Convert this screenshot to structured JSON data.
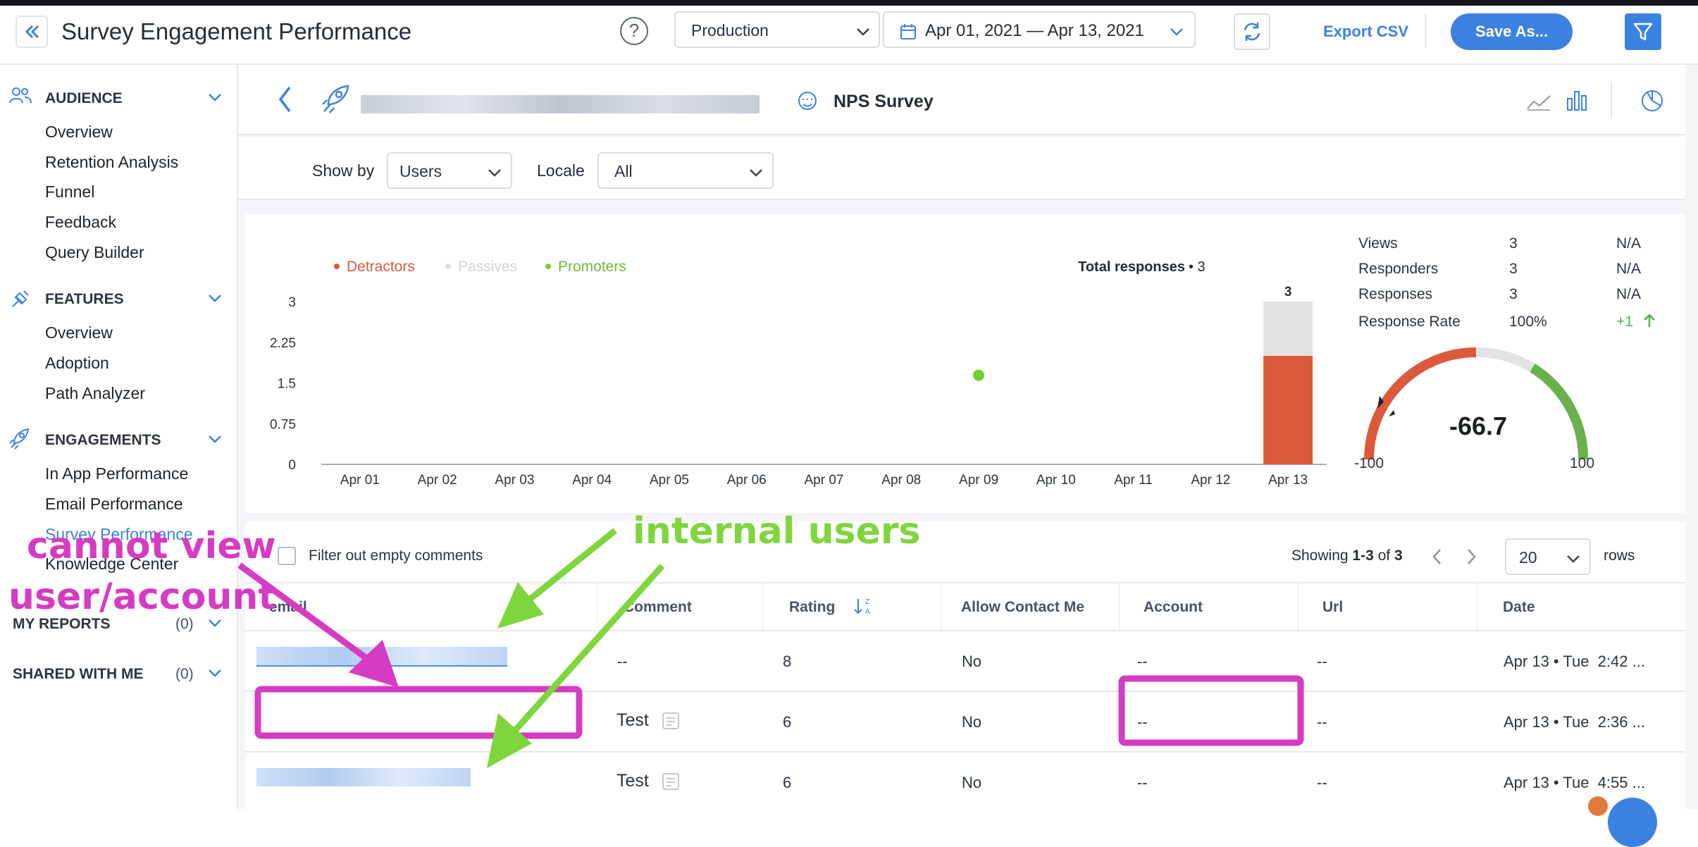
{
  "header": {
    "title": "Survey Engagement Performance",
    "environment": "Production",
    "date_range": "Apr 01, 2021 — Apr 13, 2021",
    "export_label": "Export CSV",
    "save_label": "Save As..."
  },
  "sidebar": {
    "audience": {
      "title": "AUDIENCE",
      "items": [
        "Overview",
        "Retention Analysis",
        "Funnel",
        "Feedback",
        "Query Builder"
      ]
    },
    "features": {
      "title": "FEATURES",
      "items": [
        "Overview",
        "Adoption",
        "Path Analyzer"
      ]
    },
    "engagements": {
      "title": "ENGAGEMENTS",
      "items": [
        "In App Performance",
        "Email Performance",
        "Survey Performance",
        "Knowledge Center"
      ]
    },
    "my_reports": {
      "title": "MY REPORTS",
      "count": "(0)"
    },
    "shared": {
      "title": "SHARED WITH ME",
      "count": "(0)"
    }
  },
  "subheader": {
    "survey_name": "NPS Survey"
  },
  "filters": {
    "show_by_label": "Show by",
    "show_by_value": "Users",
    "locale_label": "Locale",
    "locale_value": "All"
  },
  "chart_data": {
    "type": "bar",
    "legend": [
      "Detractors",
      "Passives",
      "Promoters"
    ],
    "colors": {
      "detractors": "#dc5a3c",
      "passives": "#e3e3e3",
      "promoters": "#6fcf2f"
    },
    "categories": [
      "Apr 01",
      "Apr 02",
      "Apr 03",
      "Apr 04",
      "Apr 05",
      "Apr 06",
      "Apr 07",
      "Apr 08",
      "Apr 09",
      "Apr 10",
      "Apr 11",
      "Apr 12",
      "Apr 13"
    ],
    "series": [
      {
        "name": "Detractors",
        "values": [
          0,
          0,
          0,
          0,
          0,
          0,
          0,
          0,
          0,
          0,
          0,
          0,
          2
        ]
      },
      {
        "name": "Passives",
        "values": [
          0,
          0,
          0,
          0,
          0,
          0,
          0,
          0,
          0,
          0,
          0,
          0,
          1
        ]
      },
      {
        "name": "Promoters",
        "values": [
          0,
          0,
          0,
          0,
          0,
          0,
          0,
          0,
          0,
          0,
          0,
          0,
          0
        ]
      }
    ],
    "promoter_point": {
      "x": "Apr 09",
      "y": 1.5
    },
    "bar_top_label": "3",
    "yticks": [
      "3",
      "2.25",
      "1.5",
      "0.75",
      "0"
    ],
    "ylim": [
      0,
      3
    ],
    "total_label": "Total responses",
    "total_value": "• 3"
  },
  "stats": {
    "rows": [
      {
        "label": "Views",
        "value": "3",
        "extra": "N/A"
      },
      {
        "label": "Responders",
        "value": "3",
        "extra": "N/A"
      },
      {
        "label": "Responses",
        "value": "3",
        "extra": "N/A"
      },
      {
        "label": "Response Rate",
        "value": "100%",
        "extra": "+1"
      }
    ],
    "nps": "-66.7",
    "gauge_min": "-100",
    "gauge_max": "100"
  },
  "table": {
    "filter_label": "Filter out empty comments",
    "showing_prefix": "Showing ",
    "showing_range": "1-3",
    "showing_of": " of ",
    "showing_total": "3",
    "page_size": "20",
    "rows_label": "rows",
    "columns": [
      "email",
      "Comment",
      "Rating",
      "Allow Contact Me",
      "Account",
      "Url",
      "Date"
    ],
    "rows": [
      {
        "comment": "--",
        "rating": "8",
        "allow": "No",
        "account": "--",
        "url": "--",
        "date": "Apr 13 • Tue  2:42 ..."
      },
      {
        "comment": "Test",
        "rating": "6",
        "allow": "No",
        "account": "--",
        "url": "--",
        "date": "Apr 13 • Tue  2:36 ..."
      },
      {
        "comment": "Test",
        "rating": "6",
        "allow": "No",
        "account": "--",
        "url": "--",
        "date": "Apr 13 • Tue  4:55 ..."
      }
    ]
  },
  "annotations": {
    "internal": "internal users",
    "cannot_line1": "cannot view",
    "cannot_line2": "user/account"
  }
}
